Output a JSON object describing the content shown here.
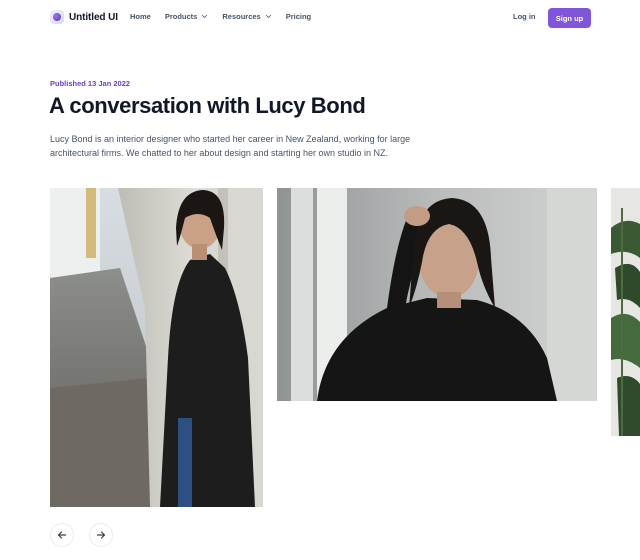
{
  "header": {
    "logo_text": "Untitled UI",
    "nav": [
      {
        "label": "Home"
      },
      {
        "label": "Products",
        "has_dropdown": true
      },
      {
        "label": "Resources",
        "has_dropdown": true
      },
      {
        "label": "Pricing"
      }
    ],
    "login_label": "Log in",
    "signup_label": "Sign up"
  },
  "article": {
    "published": "Published 13 Jan 2022",
    "title": "A conversation with Lucy Bond",
    "lead": "Lucy Bond is an interior designer who started her career in New Zealand, working for large architectural firms. We chatted to her about design and starting her own studio in NZ."
  },
  "gallery": {
    "images": [
      {
        "icon": "photo-woman-leaning-on-pillar"
      },
      {
        "icon": "photo-woman-portrait-hand-in-hair"
      },
      {
        "icon": "photo-plant-partial"
      }
    ]
  },
  "controls": {
    "prev_icon": "arrow-left-icon",
    "next_icon": "arrow-right-icon"
  },
  "colors": {
    "brand": "#7f56d9",
    "brand_text": "#6941c6",
    "heading": "#101828",
    "body": "#475467"
  }
}
